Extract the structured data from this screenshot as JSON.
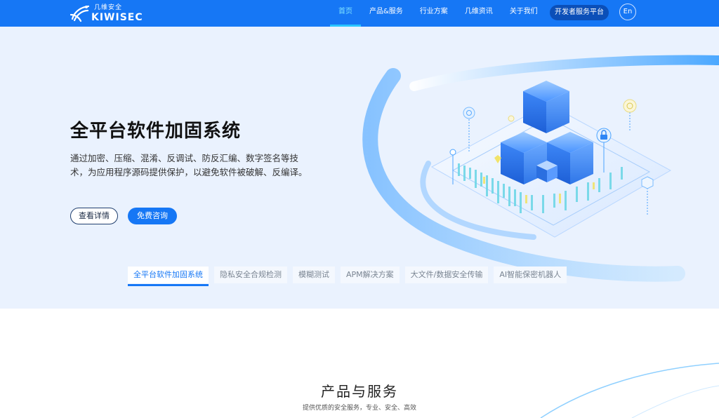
{
  "brand": {
    "name_cn": "几维安全",
    "name_en": "KIWISEC"
  },
  "nav": {
    "items": [
      {
        "label": "首页",
        "active": true
      },
      {
        "label": "产品&服务",
        "active": false
      },
      {
        "label": "行业方案",
        "active": false
      },
      {
        "label": "几维资讯",
        "active": false
      },
      {
        "label": "关于我们",
        "active": false
      }
    ],
    "developer_platform": "开发者服务平台",
    "language": "En"
  },
  "hero": {
    "title": "全平台软件加固系统",
    "description": "通过加密、压缩、混淆、反调试、防反汇编、数字签名等技术，为应用程序源码提供保护，以避免软件被破解、反编译。",
    "details_button": "查看详情",
    "consult_button": "免费咨询"
  },
  "tabs": [
    {
      "label": "全平台软件加固系统",
      "active": true
    },
    {
      "label": "隐私安全合规检测",
      "active": false
    },
    {
      "label": "模糊测试",
      "active": false
    },
    {
      "label": "APM解决方案",
      "active": false
    },
    {
      "label": "大文件/数据安全传输",
      "active": false
    },
    {
      "label": "AI智能保密机器人",
      "active": false
    }
  ],
  "section": {
    "title": "产品与服务",
    "subtitle": "提供优质的安全服务，专业、安全、高效"
  },
  "colors": {
    "primary": "#1677f5",
    "hero_bg": "#eaf2fe",
    "active_nav": "#7fe3ff",
    "dev_btn_bg": "#0b4fb8"
  }
}
